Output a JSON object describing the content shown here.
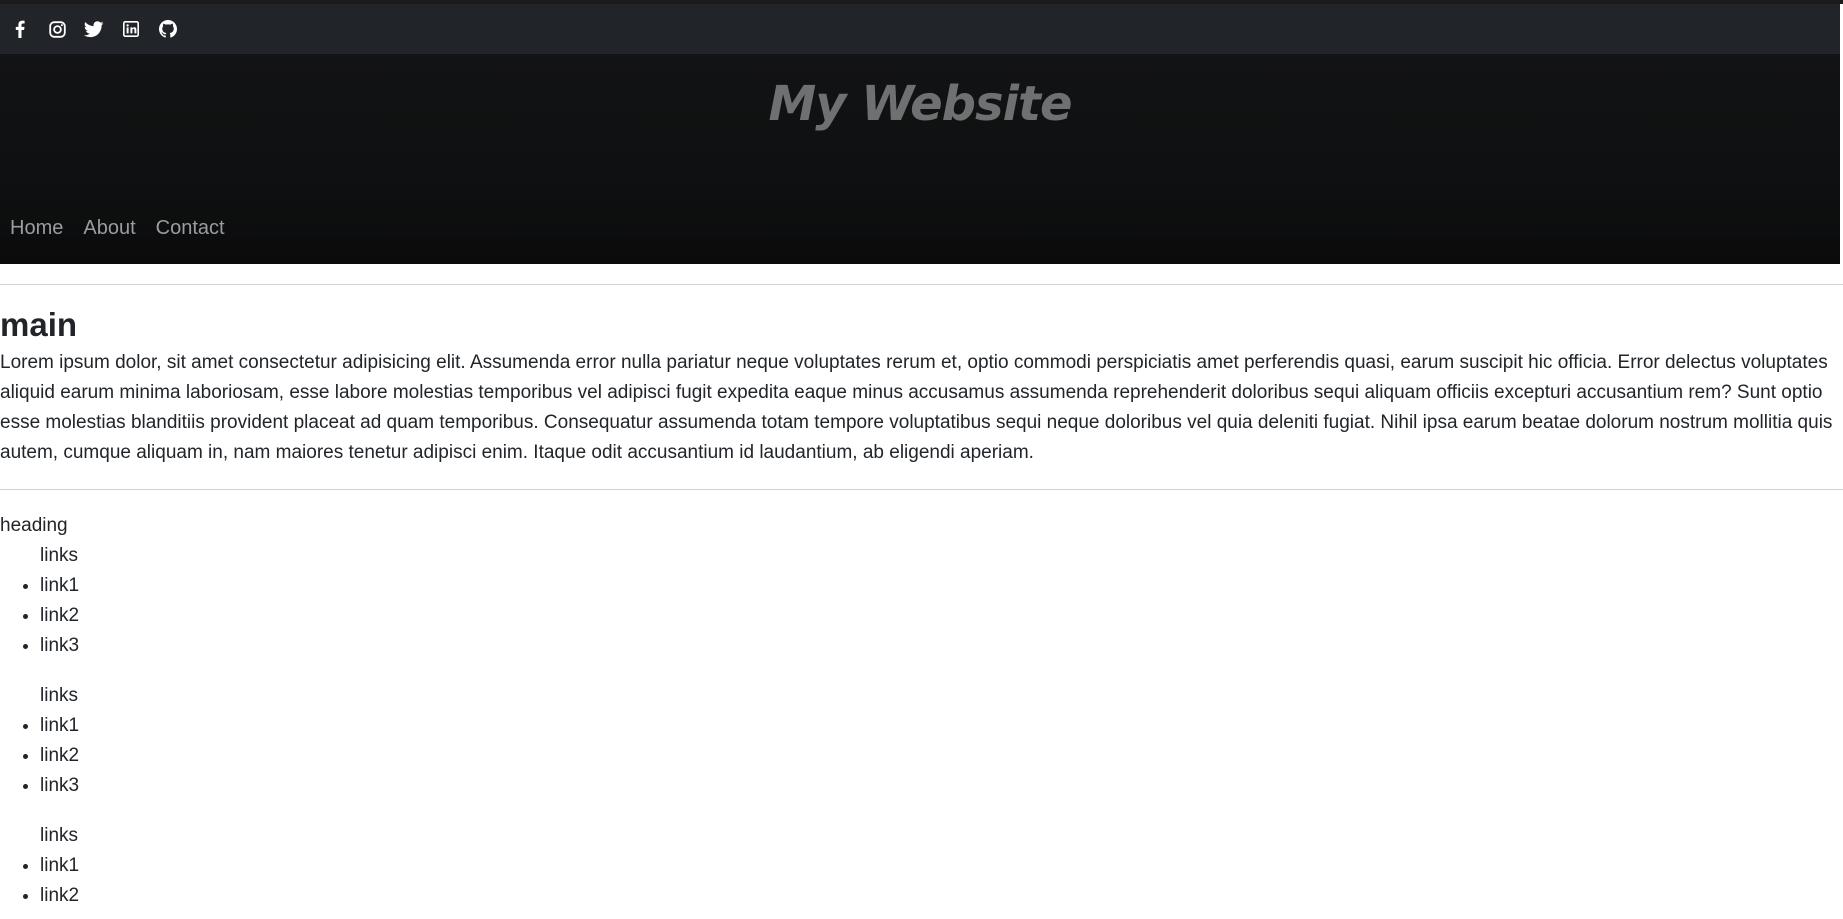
{
  "social": {
    "icons": [
      "facebook-icon",
      "instagram-icon",
      "twitter-icon",
      "linkedin-icon",
      "github-icon"
    ]
  },
  "header": {
    "title": "My Website"
  },
  "nav": {
    "items": [
      {
        "label": "Home"
      },
      {
        "label": "About"
      },
      {
        "label": "Contact"
      }
    ]
  },
  "main": {
    "heading": "main",
    "paragraph": "Lorem ipsum dolor, sit amet consectetur adipisicing elit. Assumenda error nulla pariatur neque voluptates rerum et, optio commodi perspiciatis amet perferendis quasi, earum suscipit hic officia. Error delectus voluptates aliquid earum minima laboriosam, esse labore molestias temporibus vel adipisci fugit expedita eaque minus accusamus assumenda reprehenderit doloribus sequi aliquam officiis excepturi accusantium rem? Sunt optio esse molestias blanditiis provident placeat ad quam temporibus. Consequatur assumenda totam tempore voluptatibus sequi neque doloribus vel quia deleniti fugiat. Nihil ipsa earum beatae dolorum nostrum mollitia quis autem, cumque aliquam in, nam maiores tenetur adipisci enim. Itaque odit accusantium id laudantium, ab eligendi aperiam."
  },
  "footer": {
    "heading": "heading",
    "groups": [
      {
        "title": "links",
        "links": [
          "link1",
          "link2",
          "link3"
        ]
      },
      {
        "title": "links",
        "links": [
          "link1",
          "link2",
          "link3"
        ]
      },
      {
        "title": "links",
        "links": [
          "link1",
          "link2"
        ]
      }
    ]
  },
  "colors": {
    "social_bar": "#212529",
    "hero": "#0f1011",
    "title": "#6f7071",
    "nav_link": "#9a9da0"
  }
}
